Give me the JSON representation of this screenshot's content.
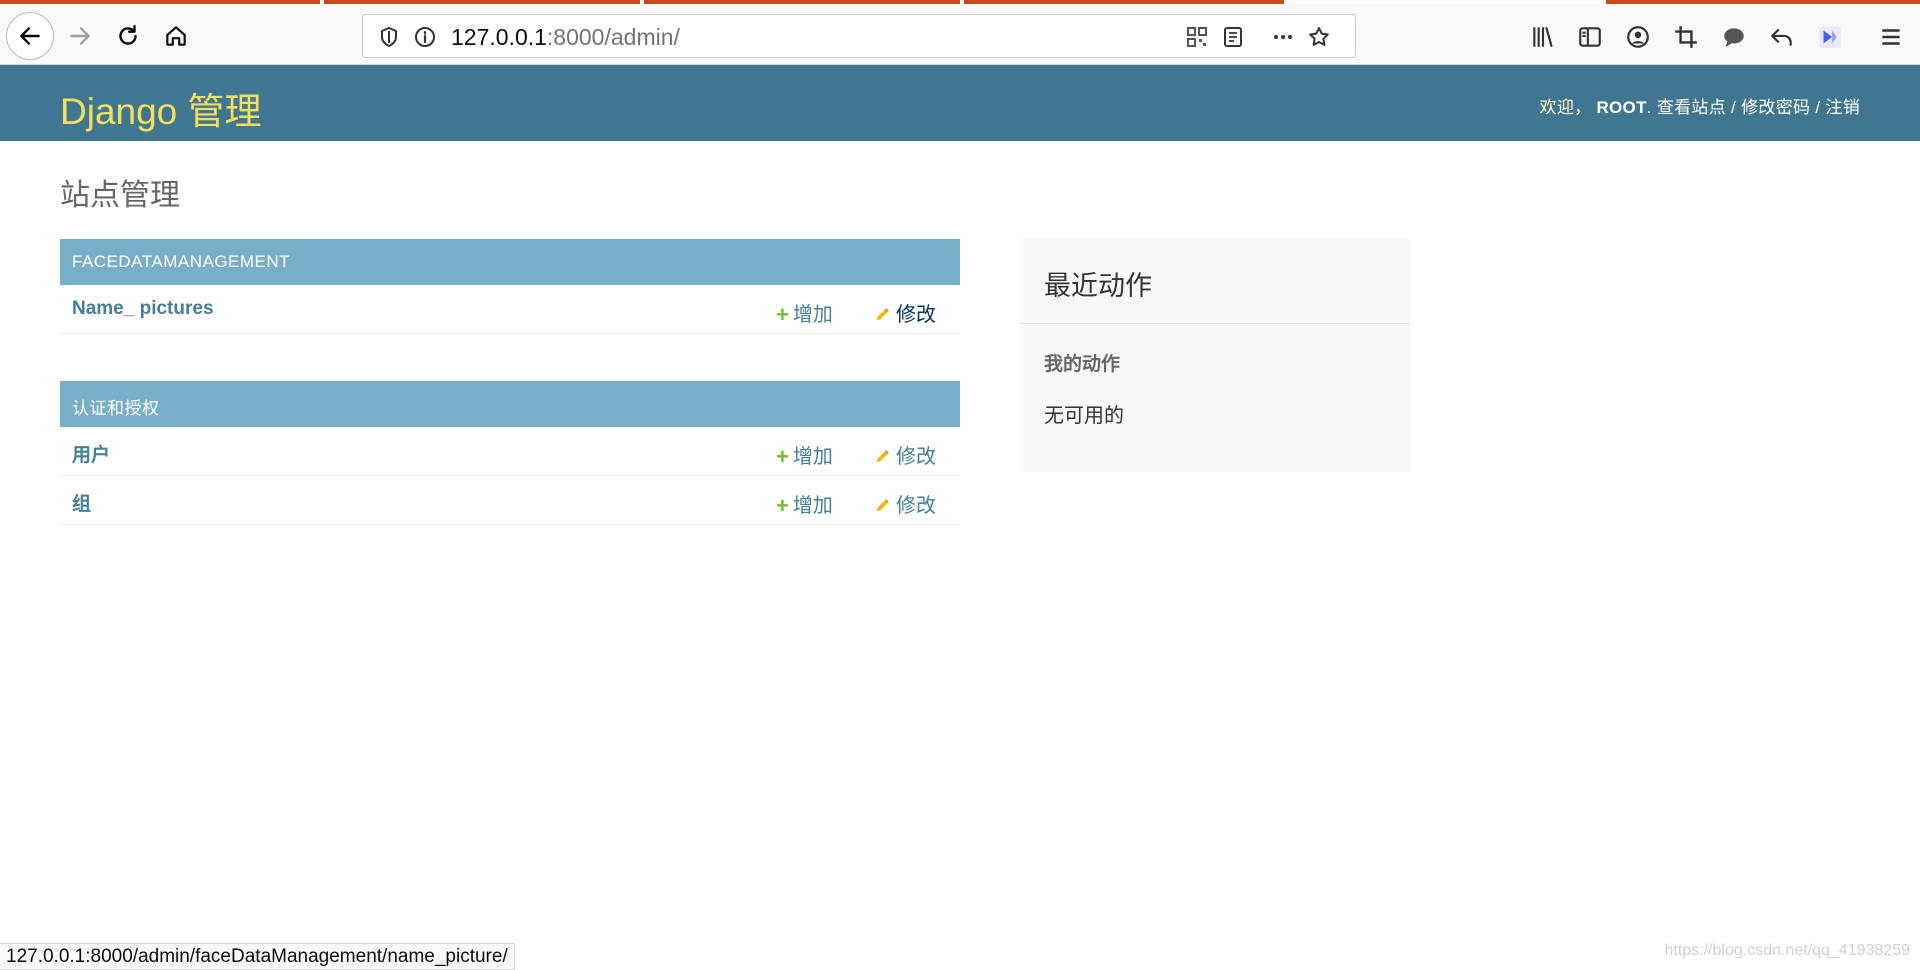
{
  "browser": {
    "url_host": "127.0.0.1",
    "url_rest": ":8000/admin/",
    "icons": [
      "back-icon",
      "forward-icon",
      "reload-icon",
      "home-icon",
      "shield-icon",
      "info-icon",
      "qr-code-icon",
      "reader-view-icon",
      "more-icon",
      "bookmark-star-icon",
      "library-icon",
      "sidebar-icon",
      "account-icon",
      "screenshot-icon",
      "chat-icon",
      "undo-icon",
      "extension-icon",
      "menu-icon"
    ]
  },
  "header": {
    "brand": "Django 管理",
    "welcome": "欢迎，",
    "username": "ROOT",
    "sep1": ".",
    "view_site": "查看站点",
    "slash1": " / ",
    "change_password": "修改密码",
    "slash2": " / ",
    "logout": "注销"
  },
  "page": {
    "title": "站点管理"
  },
  "modules": [
    {
      "caption": "FACEDATAMANAGEMENT",
      "rows": [
        {
          "model": "Name_ pictures",
          "add": "增加",
          "change": "修改"
        }
      ]
    },
    {
      "caption": "认证和授权",
      "rows": [
        {
          "model": "用户",
          "add": "增加",
          "change": "修改"
        },
        {
          "model": "组",
          "add": "增加",
          "change": "修改"
        }
      ]
    }
  ],
  "recent_actions": {
    "title": "最近动作",
    "my_actions": "我的动作",
    "none_available": "无可用的"
  },
  "statusbar": {
    "link": "127.0.0.1:8000/admin/faceDataManagement/name_picture/"
  },
  "watermark": "https://blog.csdn.net/qq_41938259",
  "colors": {
    "header_bg": "#417690",
    "brand": "#f5dd5d",
    "module_caption_bg": "#79aec8",
    "link": "#447e9b",
    "add_icon": "#70bf2b",
    "change_icon": "#efb80b"
  }
}
